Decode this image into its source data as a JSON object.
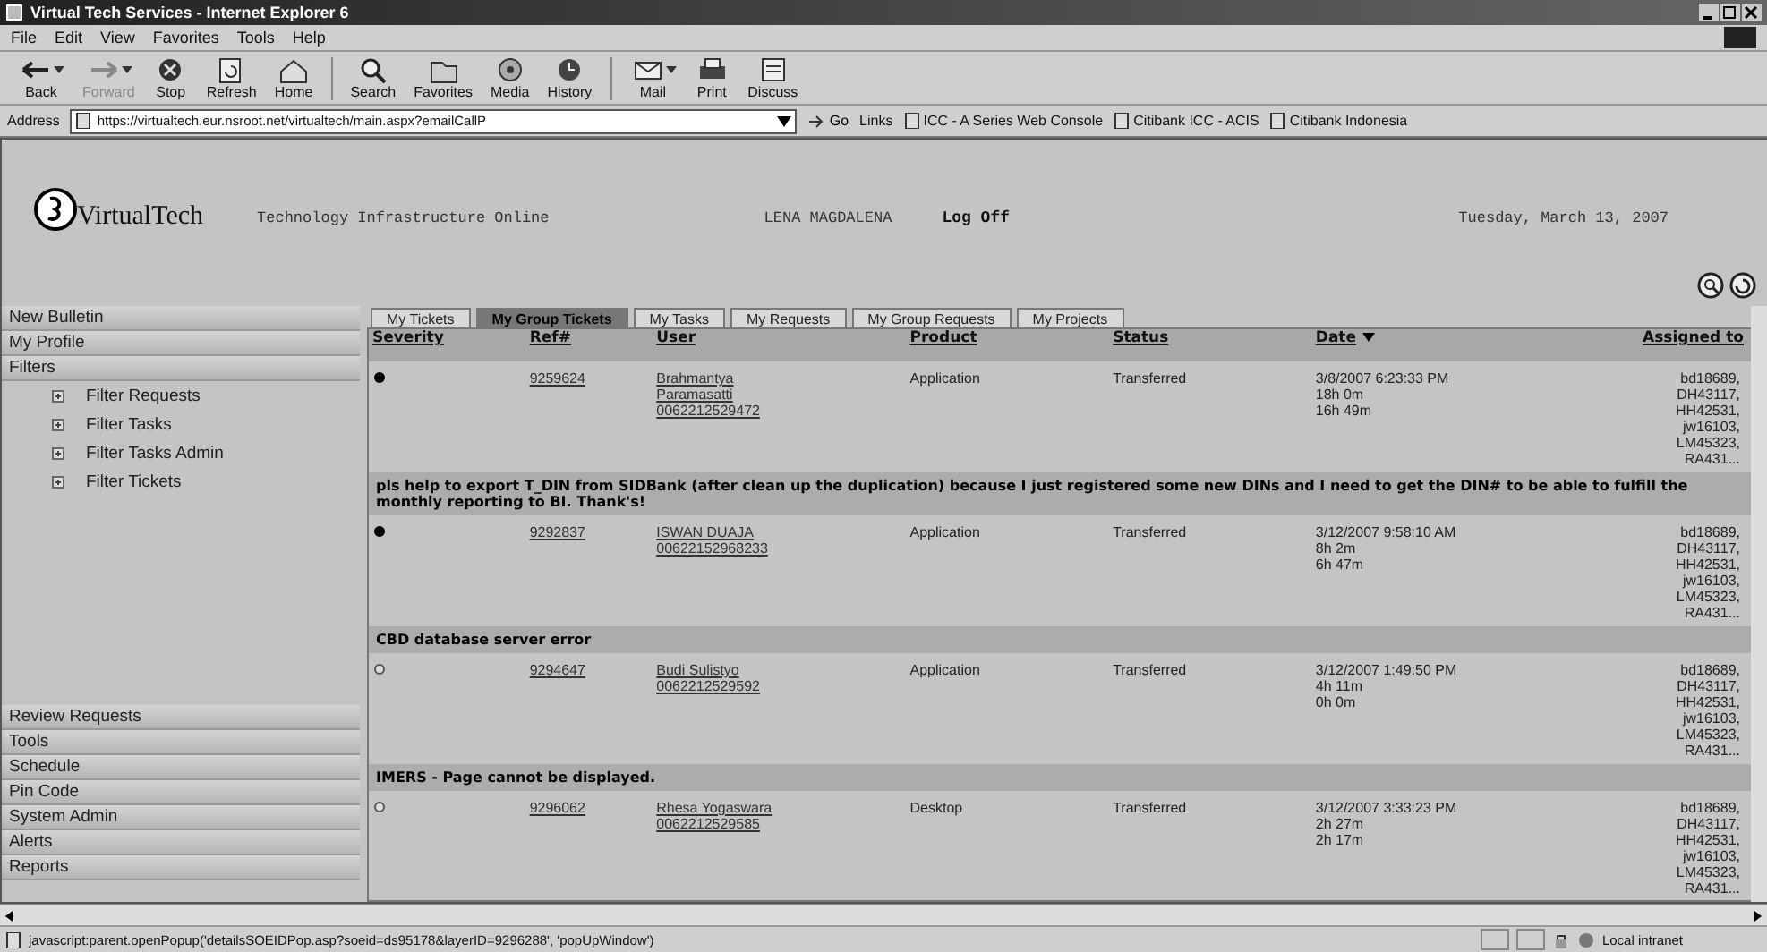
{
  "window": {
    "title": "Virtual Tech Services - Internet Explorer 6"
  },
  "menu": [
    "File",
    "Edit",
    "View",
    "Favorites",
    "Tools",
    "Help"
  ],
  "toolbar": [
    {
      "label": "Back",
      "disabled": false,
      "dropdown": true
    },
    {
      "label": "Forward",
      "disabled": true,
      "dropdown": true
    },
    {
      "label": "Stop",
      "disabled": false,
      "dropdown": false
    },
    {
      "label": "Refresh",
      "disabled": false,
      "dropdown": false
    },
    {
      "label": "Home",
      "disabled": false,
      "dropdown": false
    },
    {
      "label": "Search",
      "disabled": false,
      "dropdown": false
    },
    {
      "label": "Favorites",
      "disabled": false,
      "dropdown": false
    },
    {
      "label": "Media",
      "disabled": false,
      "dropdown": false
    },
    {
      "label": "History",
      "disabled": false,
      "dropdown": false
    },
    {
      "label": "Mail",
      "disabled": false,
      "dropdown": true
    },
    {
      "label": "Print",
      "disabled": false,
      "dropdown": false
    },
    {
      "label": "Discuss",
      "disabled": false,
      "dropdown": false
    }
  ],
  "address_bar": {
    "label": "Address",
    "value": "https://virtualtech.eur.nsroot.net/virtualtech/main.aspx?emailCallP",
    "go": "Go"
  },
  "links": {
    "label": "Links",
    "items": [
      "ICC - A Series Web Console",
      "Citibank ICC - ACIS",
      "Citibank Indonesia"
    ]
  },
  "header": {
    "logo": "VirtualTech",
    "tagline": "Technology Infrastructure Online",
    "user": "LENA MAGDALENA",
    "logoff": "Log Off",
    "date": "Tuesday, March 13, 2007"
  },
  "sidebar": {
    "top": [
      {
        "label": "New Bulletin"
      },
      {
        "label": "My Profile"
      },
      {
        "label": "Filters",
        "children": [
          {
            "label": "Filter Requests"
          },
          {
            "label": "Filter Tasks"
          },
          {
            "label": "Filter Tasks Admin"
          },
          {
            "label": "Filter Tickets"
          }
        ]
      }
    ],
    "bottom": [
      {
        "label": "Review Requests"
      },
      {
        "label": "Tools"
      },
      {
        "label": "Schedule"
      },
      {
        "label": "Pin Code"
      },
      {
        "label": "System Admin"
      },
      {
        "label": "Alerts"
      },
      {
        "label": "Reports"
      }
    ]
  },
  "tabs": [
    {
      "label": "My Tickets",
      "selected": false
    },
    {
      "label": "My Group Tickets",
      "selected": true
    },
    {
      "label": "My Tasks",
      "selected": false
    },
    {
      "label": "My Requests",
      "selected": false
    },
    {
      "label": "My Group Requests",
      "selected": false
    },
    {
      "label": "My Projects",
      "selected": false
    }
  ],
  "table": {
    "columns": [
      {
        "label": "Severity",
        "sorted": false
      },
      {
        "label": "Ref#",
        "sorted": false
      },
      {
        "label": "User",
        "sorted": false
      },
      {
        "label": "Product",
        "sorted": false
      },
      {
        "label": "Status",
        "sorted": false
      },
      {
        "label": "Date",
        "sorted": true
      },
      {
        "label": "Assigned to",
        "sorted": false
      }
    ],
    "rows": [
      {
        "severity_filled": true,
        "ref": "9259624",
        "user": [
          "Brahmantya",
          "Paramasatti",
          "0062212529472"
        ],
        "product": "Application",
        "status": "Transferred",
        "date": [
          "3/8/2007 6:23:33 PM",
          "18h 0m",
          "16h 49m"
        ],
        "assigned": [
          "bd18689,",
          "DH43117,",
          "HH42531,",
          "jw16103,",
          "LM45323,",
          "RA431..."
        ],
        "description": "pls help to export T_DIN from SIDBank (after clean up the duplication) because I just registered some new DINs and I need to get the DIN# to be able to fulfill the monthly reporting to BI. Thank's!"
      },
      {
        "severity_filled": true,
        "ref": "9292837",
        "user": [
          "ISWAN DUAJA",
          "00622152968233"
        ],
        "product": "Application",
        "status": "Transferred",
        "date": [
          "3/12/2007 9:58:10 AM",
          "8h 2m",
          "6h 47m"
        ],
        "assigned": [
          "bd18689,",
          "DH43117,",
          "HH42531,",
          "jw16103,",
          "LM45323,",
          "RA431..."
        ],
        "description": "CBD database server error"
      },
      {
        "severity_filled": false,
        "ref": "9294647",
        "user": [
          "Budi Sulistyo",
          "0062212529592"
        ],
        "product": "Application",
        "status": "Transferred",
        "date": [
          "3/12/2007 1:49:50 PM",
          "4h 11m",
          "0h 0m"
        ],
        "assigned": [
          "bd18689,",
          "DH43117,",
          "HH42531,",
          "jw16103,",
          "LM45323,",
          "RA431..."
        ],
        "description": "IMERS - Page cannot be displayed."
      },
      {
        "severity_filled": false,
        "ref": "9296062",
        "user": [
          "Rhesa Yogaswara",
          "0062212529585"
        ],
        "product": "Desktop",
        "status": "Transferred",
        "date": [
          "3/12/2007 3:33:23 PM",
          "2h 27m",
          "2h 17m"
        ],
        "assigned": [
          "bd18689,",
          "DH43117,",
          "HH42531,",
          "jw16103,",
          "LM45323,",
          "RA431..."
        ]
      }
    ]
  },
  "status_bar": {
    "text": "javascript:parent.openPopup('detailsSOEIDPop.asp?soeid=ds95178&layerID=9296288', 'popUpWindow')",
    "zone": "Local intranet"
  }
}
